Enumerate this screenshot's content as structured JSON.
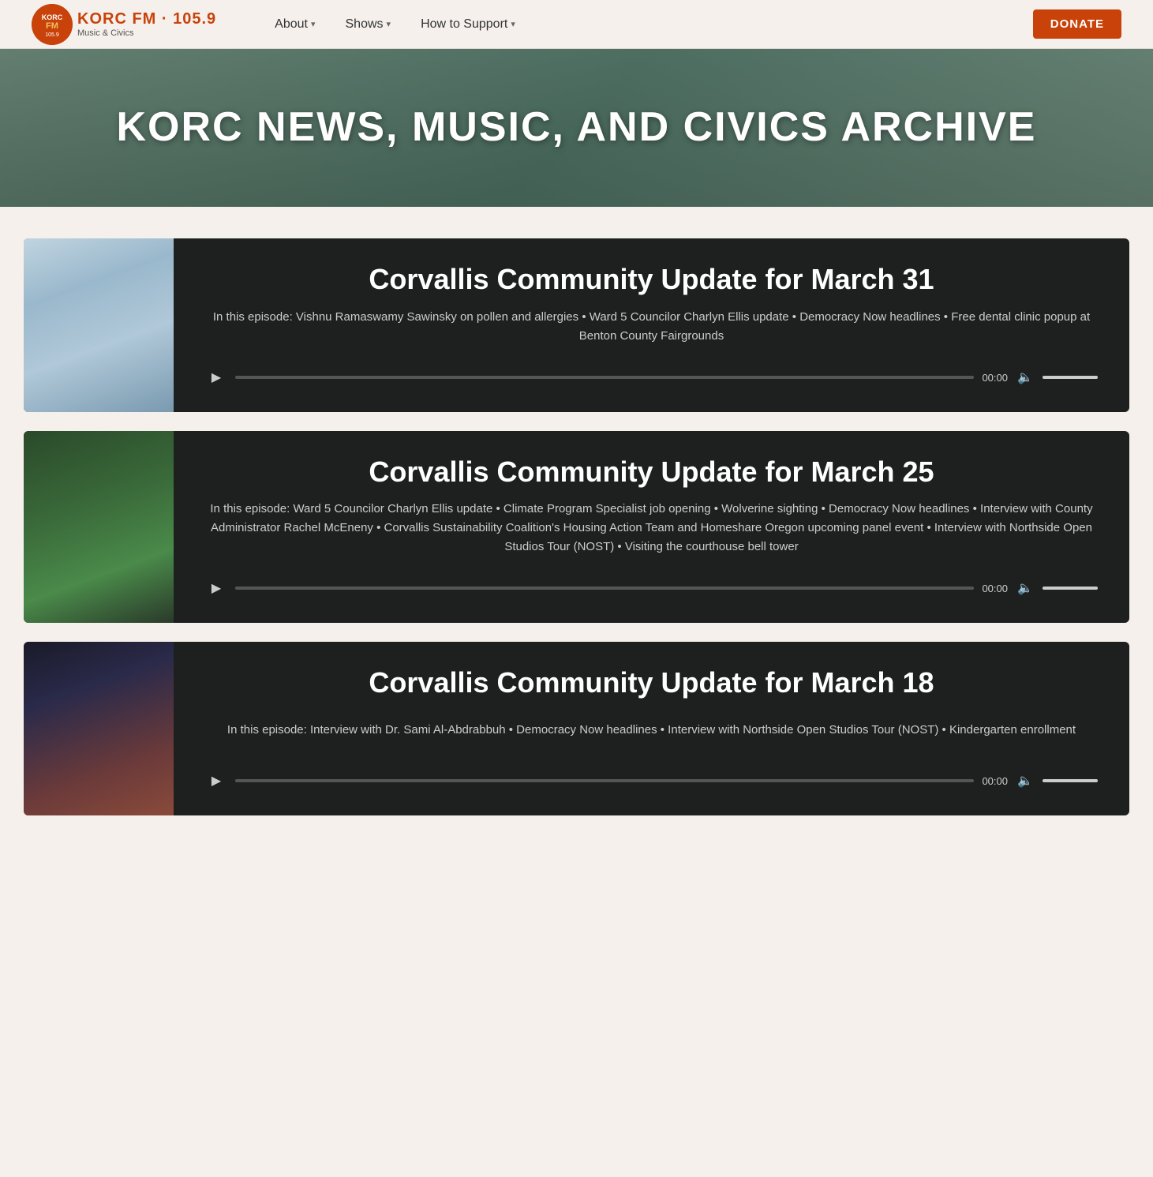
{
  "nav": {
    "logo_main": "KORC FM · 105.9",
    "logo_sub": "Music & Civics",
    "links": [
      {
        "label": "About",
        "has_dropdown": true
      },
      {
        "label": "Shows",
        "has_dropdown": true
      },
      {
        "label": "How to Support",
        "has_dropdown": true
      }
    ],
    "donate_label": "DONATE"
  },
  "hero": {
    "title": "KORC NEWS, MUSIC, AND CIVICS ARCHIVE"
  },
  "episodes": [
    {
      "title": "Corvallis Community Update for March 31",
      "description": "In this episode: Vishnu Ramaswamy Sawinsky on pollen and allergies • Ward 5 Councilor Charlyn Ellis update • Democracy Now headlines • Free dental clinic popup at Benton County Fairgrounds",
      "time": "00:00",
      "image_class": "episode-image-1"
    },
    {
      "title": "Corvallis Community Update for March 25",
      "description": "In this episode: Ward 5 Councilor Charlyn Ellis update • Climate Program Specialist job opening • Wolverine sighting • Democracy Now headlines • Interview with County Administrator Rachel McEneny • Corvallis Sustainability Coalition's Housing Action Team and Homeshare Oregon upcoming panel event • Interview with Northside Open Studios Tour (NOST) • Visiting the courthouse bell tower",
      "time": "00:00",
      "image_class": "episode-image-2"
    },
    {
      "title": "Corvallis Community Update for March 18",
      "description": "In this episode: Interview with Dr. Sami Al-Abdrabbuh • Democracy Now headlines • Interview with Northside Open Studios Tour (NOST) • Kindergarten enrollment",
      "time": "00:00",
      "image_class": "episode-image-3"
    }
  ]
}
